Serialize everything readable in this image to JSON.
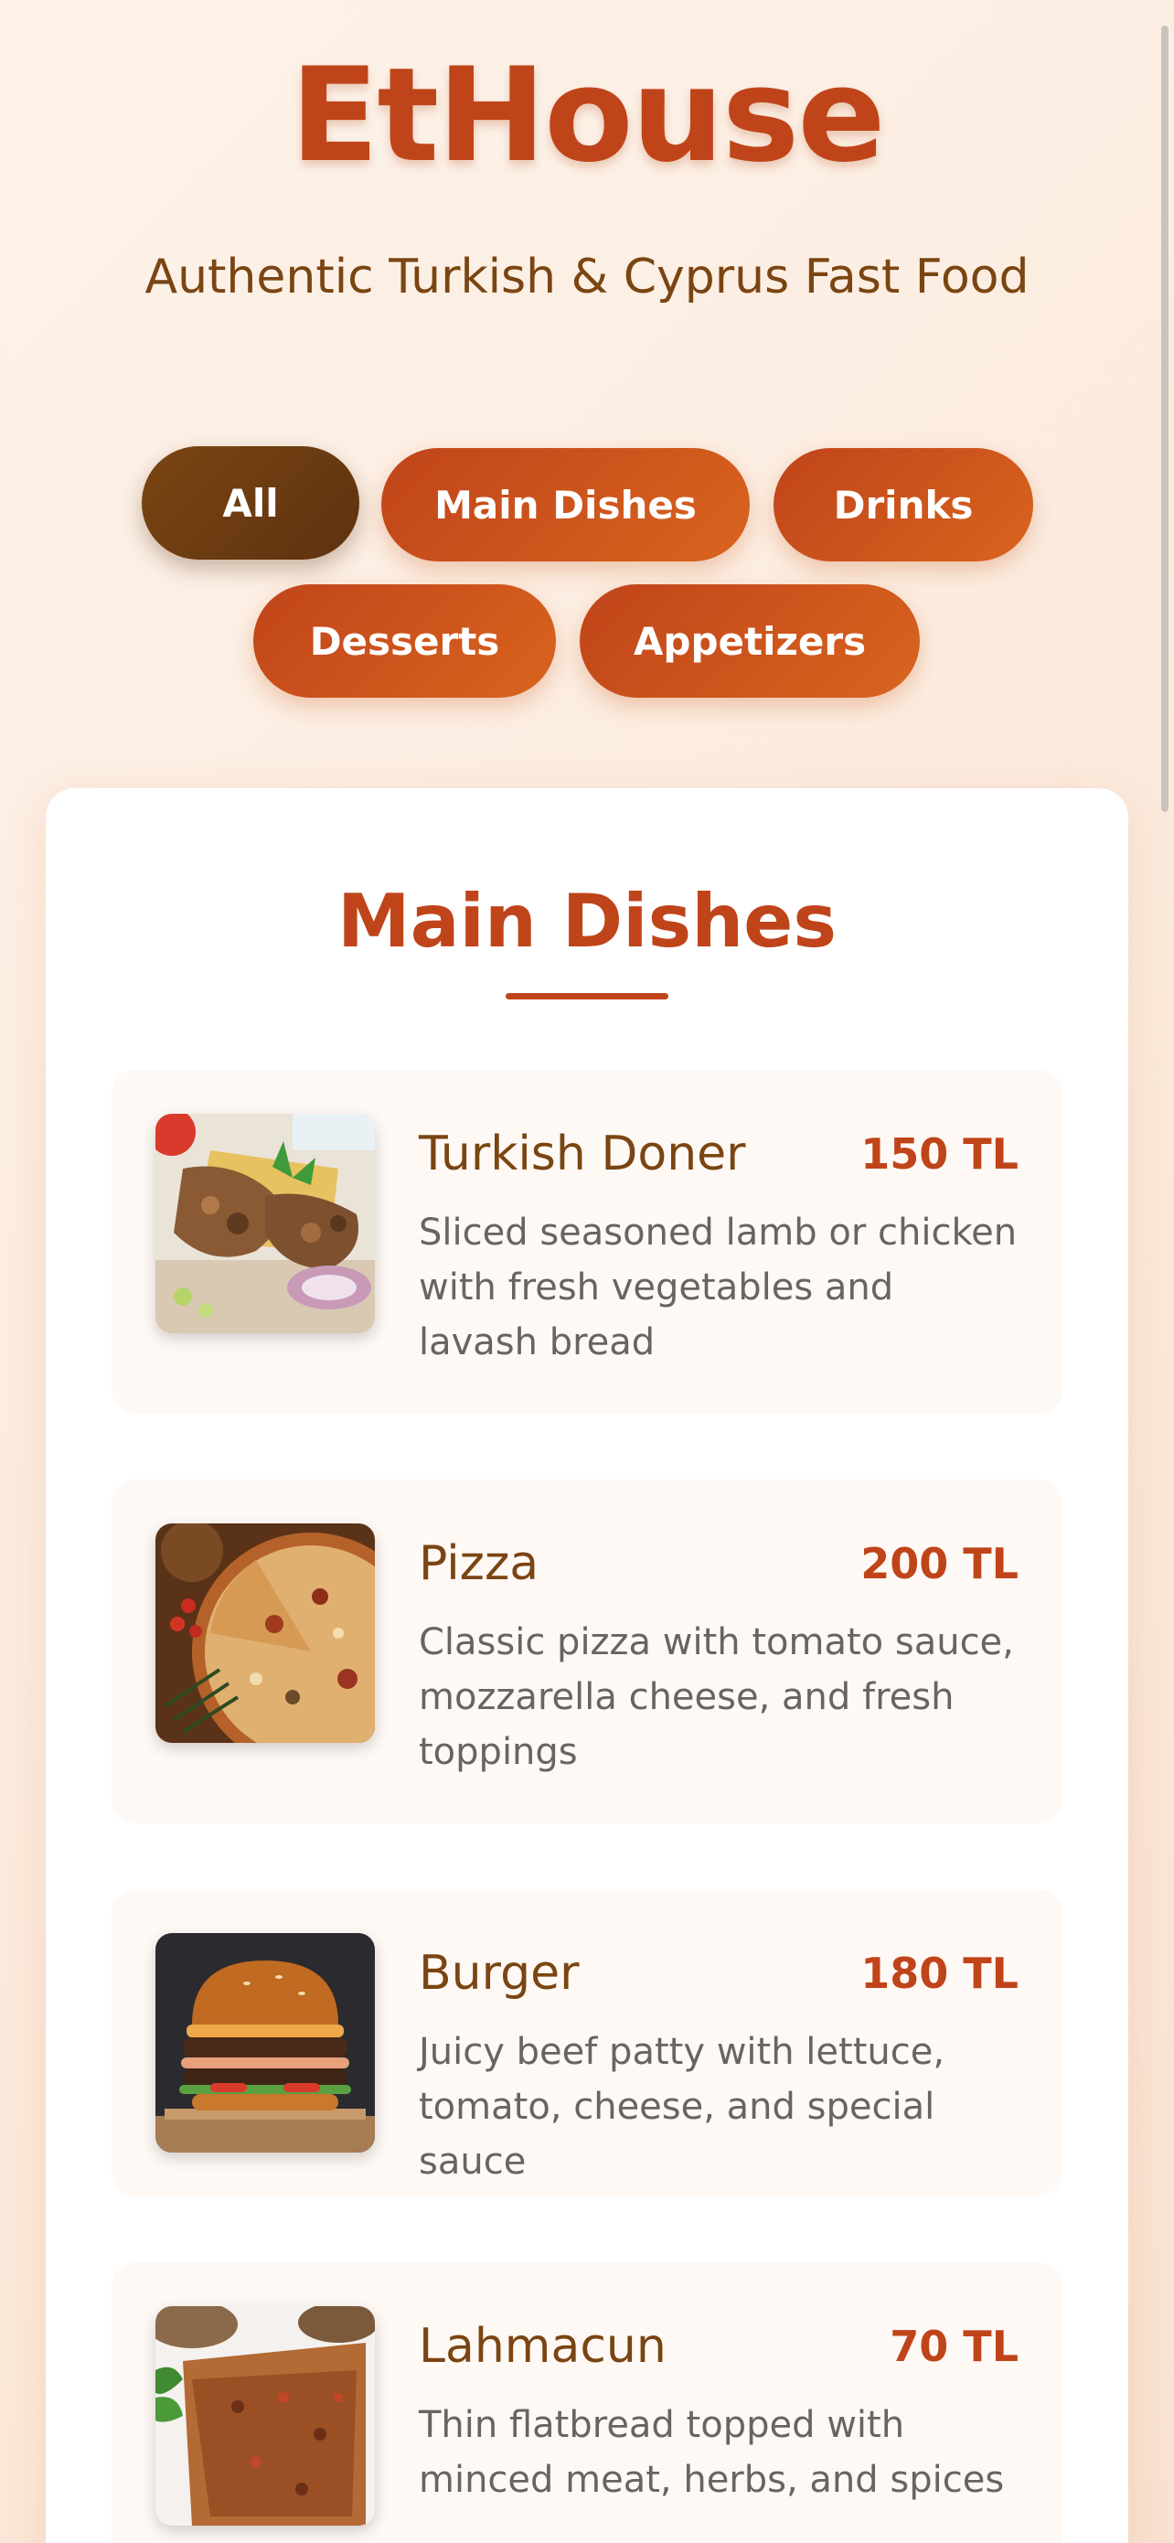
{
  "header": {
    "title": "EtHouse",
    "tagline": "Authentic Turkish & Cyprus Fast Food"
  },
  "tabs": [
    {
      "label": "All",
      "active": true
    },
    {
      "label": "Main Dishes",
      "active": false
    },
    {
      "label": "Drinks",
      "active": false
    },
    {
      "label": "Desserts",
      "active": false
    },
    {
      "label": "Appetizers",
      "active": false
    }
  ],
  "section": {
    "title": "Main Dishes",
    "items": [
      {
        "name": "Turkish Doner",
        "price": "150 TL",
        "description": "Sliced seasoned lamb or chicken with fresh vegetables and lavash bread",
        "image": "doner-photo"
      },
      {
        "name": "Pizza",
        "price": "200 TL",
        "description": "Classic pizza with tomato sauce, mozzarella cheese, and fresh toppings",
        "image": "pizza-photo"
      },
      {
        "name": "Burger",
        "price": "180 TL",
        "description": "Juicy beef patty with lettuce, tomato, cheese, and special sauce",
        "image": "burger-photo"
      },
      {
        "name": "Lahmacun",
        "price": "70 TL",
        "description": "Thin flatbread topped with minced meat, herbs, and spices",
        "image": "lahmacun-photo"
      }
    ]
  },
  "colors": {
    "brand": "#c0441a",
    "brown": "#7a4512",
    "tab_active": "#6b3a12",
    "background": "#fdf3ea"
  }
}
